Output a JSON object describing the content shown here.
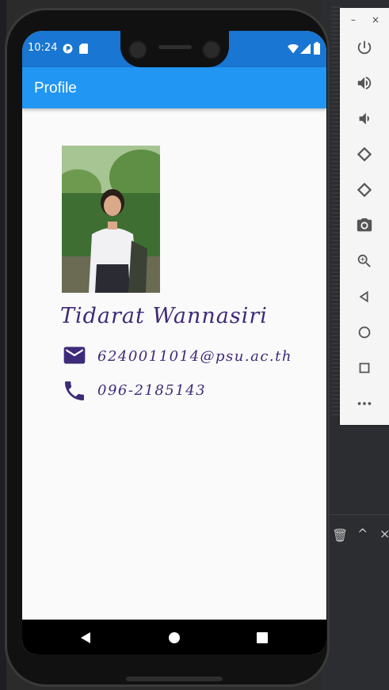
{
  "status_bar": {
    "time": "10:24"
  },
  "app_bar": {
    "title": "Profile"
  },
  "profile": {
    "name": "Tidarat Wannasiri",
    "email": "6240011014@psu.ac.th",
    "phone": "096-2185143"
  },
  "colors": {
    "status_bar": "#1976d2",
    "app_bar": "#2196f3",
    "text_accent": "#3d2a78",
    "background": "#fafafa"
  },
  "emulator_panel": {
    "window_controls": [
      "minimize-icon",
      "close-icon"
    ],
    "tools": [
      "power-icon",
      "volume-up-icon",
      "volume-down-icon",
      "rotate-left-icon",
      "rotate-right-icon",
      "camera-icon",
      "zoom-icon",
      "back-icon",
      "home-icon",
      "overview-icon",
      "more-icon"
    ]
  }
}
